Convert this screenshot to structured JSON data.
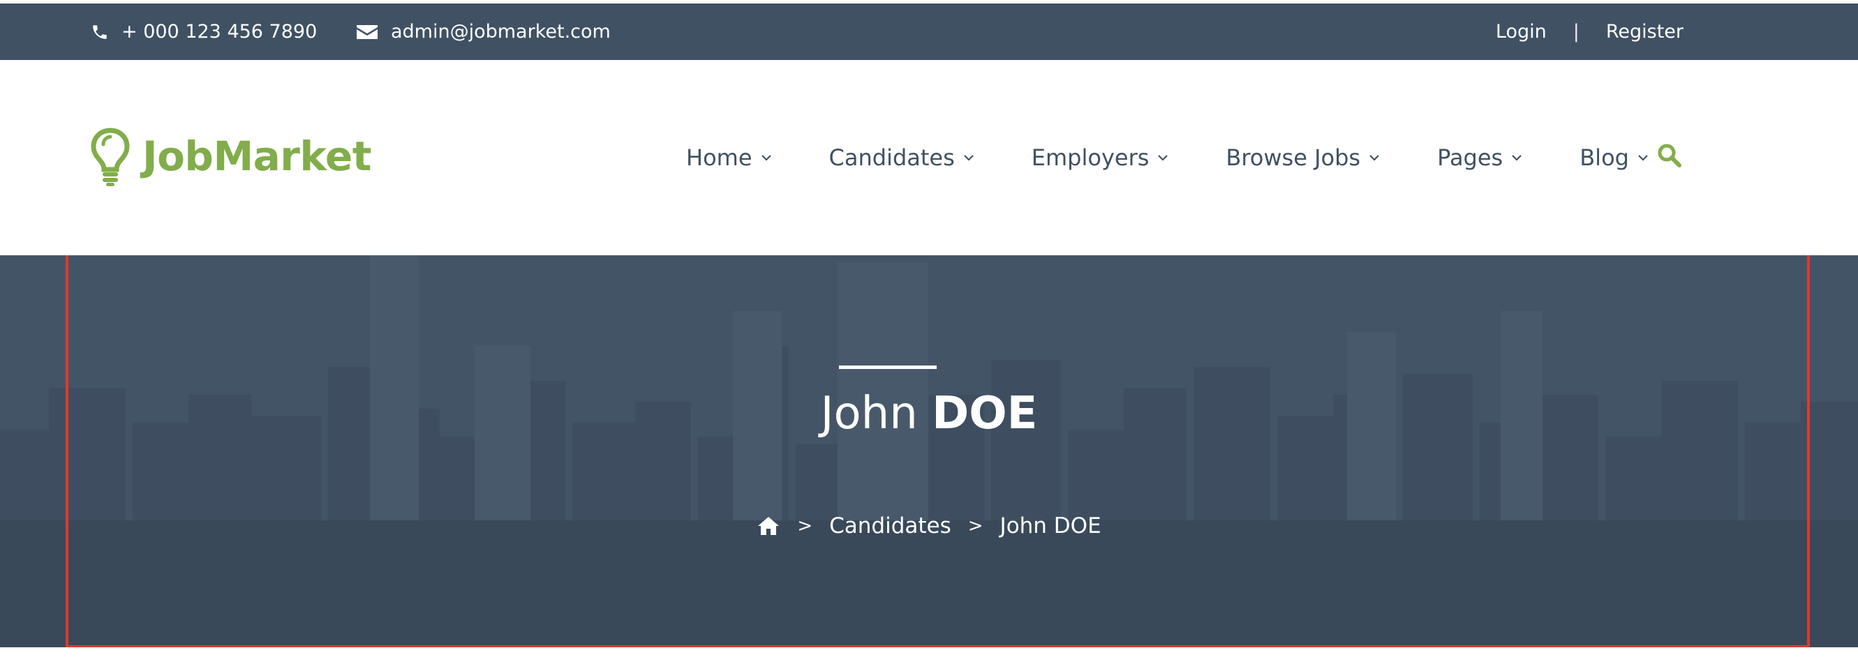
{
  "topbar": {
    "phone": "+ 000 123 456 7890",
    "email": "admin@jobmarket.com",
    "login": "Login",
    "separator": "|",
    "register": "Register",
    "background": "#3f5163"
  },
  "brand": {
    "name": "JobMarket",
    "color": "#82ad4b"
  },
  "nav": {
    "items": [
      {
        "label": "Home"
      },
      {
        "label": "Candidates"
      },
      {
        "label": "Employers"
      },
      {
        "label": "Browse Jobs"
      },
      {
        "label": "Pages"
      },
      {
        "label": "Blog"
      }
    ],
    "text_color": "#3f5163",
    "search_icon": "search-icon"
  },
  "hero": {
    "title_first": "John",
    "title_last": "DOE",
    "breadcrumb": {
      "home_icon": "home-icon",
      "separator": ">",
      "link": "Candidates",
      "current": "John DOE"
    },
    "highlight_color": "#e03a2a"
  }
}
